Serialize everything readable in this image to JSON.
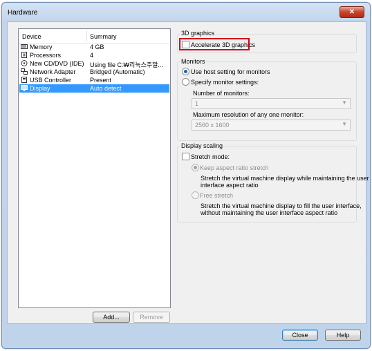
{
  "window": {
    "title": "Hardware",
    "close_glyph": "✕"
  },
  "device_list": {
    "col_device": "Device",
    "col_summary": "Summary",
    "rows": [
      {
        "name": "Memory",
        "summary": "4 GB",
        "icon": "memory-icon"
      },
      {
        "name": "Processors",
        "summary": "4",
        "icon": "processor-icon"
      },
      {
        "name": "New CD/DVD (IDE)",
        "summary": "Using file C:₩리눅스주말...",
        "icon": "cd-dvd-icon"
      },
      {
        "name": "Network Adapter",
        "summary": "Bridged (Automatic)",
        "icon": "network-adapter-icon"
      },
      {
        "name": "USB Controller",
        "summary": "Present",
        "icon": "usb-icon"
      },
      {
        "name": "Display",
        "summary": "Auto detect",
        "icon": "display-icon",
        "selected": true
      }
    ],
    "add_label": "Add...",
    "remove_label": "Remove"
  },
  "graphics3d": {
    "group_label": "3D graphics",
    "accelerate_label": "Accelerate 3D graphics",
    "accelerate_checked": false
  },
  "monitors": {
    "group_label": "Monitors",
    "use_host_label": "Use host setting for monitors",
    "specify_label": "Specify monitor settings:",
    "number_label": "Number of monitors:",
    "number_value": "1",
    "maxres_label": "Maximum resolution of any one monitor:",
    "maxres_value": "2560 x 1600"
  },
  "scaling": {
    "group_label": "Display scaling",
    "stretch_label": "Stretch mode:",
    "keep_label": "Keep aspect ratio stretch",
    "keep_desc_1": "Stretch the virtual machine display while maintaining the user",
    "keep_desc_2": "interface aspect ratio",
    "free_label": "Free stretch",
    "free_desc_1": "Stretch the virtual machine display to fill the user interface,",
    "free_desc_2": "without maintaining the user interface aspect ratio"
  },
  "footer": {
    "close_label": "Close",
    "help_label": "Help"
  },
  "colors": {
    "selection": "#3399ff",
    "highlight_box": "#d0021b"
  }
}
